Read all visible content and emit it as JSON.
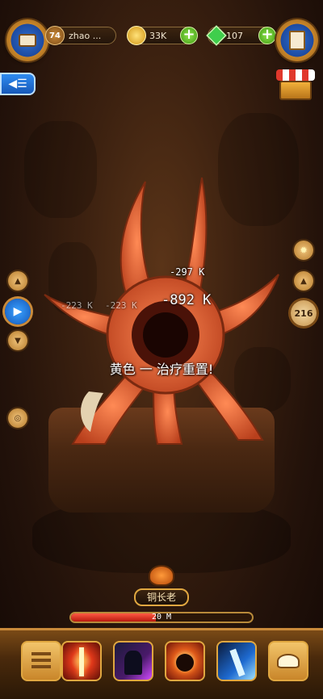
{
  "player": {
    "level": "74",
    "name": "zhao ..."
  },
  "currency": {
    "coins": "33K",
    "gems": "107"
  },
  "damage_numbers": [
    "-297 K",
    "-892 K",
    "-223 K",
    "-223 K"
  ],
  "banner": "黄色 一 治疗重置!",
  "right_counter": "216",
  "boss": {
    "title": "铜长老",
    "distance": "20 M",
    "hp_fraction": 0.47
  },
  "colors": {
    "accent": "#e0a740",
    "hp_bar": "#e03a2c",
    "gem": "#3fce4c"
  }
}
